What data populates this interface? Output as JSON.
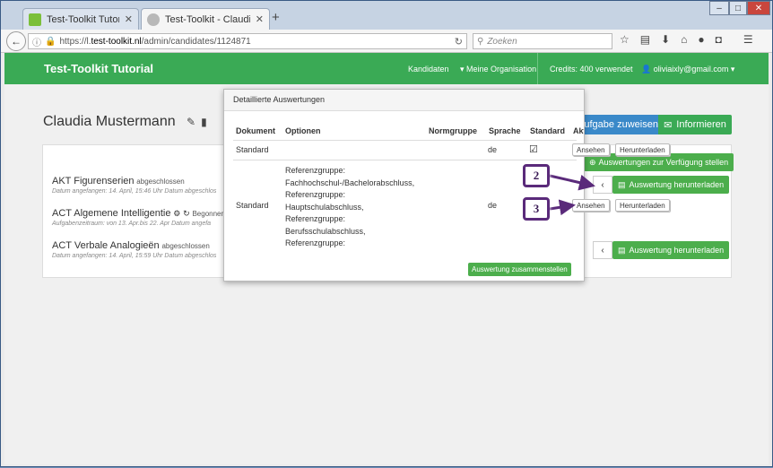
{
  "browser": {
    "tabs": [
      {
        "title": "Test-Toolkit Tutorial > Ixly",
        "favicon": "ixly-icon",
        "active": false
      },
      {
        "title": "Test-Toolkit - Claudia Mus...",
        "favicon": "ghost-icon",
        "active": true
      }
    ],
    "url_prefix": "https://l.",
    "url_domain": "test-toolkit.nl",
    "url_path": "/admin/candidates/1124871",
    "search_placeholder": "Zoeken"
  },
  "app": {
    "brand": "Test-Toolkit Tutorial",
    "nav": {
      "kandidaten": "Kandidaten",
      "organisation": "Meine Organisation",
      "credits": "Credits: 400 verwendet",
      "user": "oliviaixly@gmail.com"
    }
  },
  "candidate": {
    "name": "Claudia Mustermann",
    "assign_button": "Aufgabe zuweisen",
    "inform_button": "Informieren"
  },
  "tests": [
    {
      "title": "AKT Figurenserien",
      "status": "abgeschlossen",
      "sub": "Datum angefangen: 14. April, 15:46 Uhr Datum abgeschlos"
    },
    {
      "title": "ACT Algemene Intelligentie",
      "status": "Begonnen",
      "sub": "Aufgabenzeitraum: von 13. Apr.bis 22. Apr    Datum angefa"
    },
    {
      "title": "ACT Verbale Analogieën",
      "status": "abgeschlossen",
      "sub": "Datum angefangen: 14. April, 15:59 Uhr Datum abgeschlos"
    }
  ],
  "right_actions": {
    "provide": "Auswertungen zur Verfügung stellen",
    "download": "Auswertung herunterladen"
  },
  "modal": {
    "title": "Detaillierte Auswertungen",
    "columns": [
      "Dokument",
      "Optionen",
      "Normgruppe",
      "Sprache",
      "Standard",
      "Aktionen"
    ],
    "rows": [
      {
        "dokument": "Standard",
        "options": [],
        "sprache": "de",
        "standard_checked": true
      },
      {
        "dokument": "Standard",
        "options": [
          "Referenzgruppe:",
          "Fachhochschul-/Bachelorabschluss,",
          "Referenzgruppe:",
          "Hauptschulabschluss,",
          "Referenzgruppe:",
          "Berufsschulabschluss,",
          "Referenzgruppe:"
        ],
        "sprache": "de",
        "standard_checked": false
      }
    ],
    "view_button": "Ansehen",
    "download_button": "Herunterladen",
    "compose_button": "Auswertung zusammenstellen"
  },
  "callouts": [
    "2",
    "3"
  ],
  "colors": {
    "green": "#3aaa55",
    "blue": "#3a89c9",
    "callout": "#5a2a7a"
  }
}
